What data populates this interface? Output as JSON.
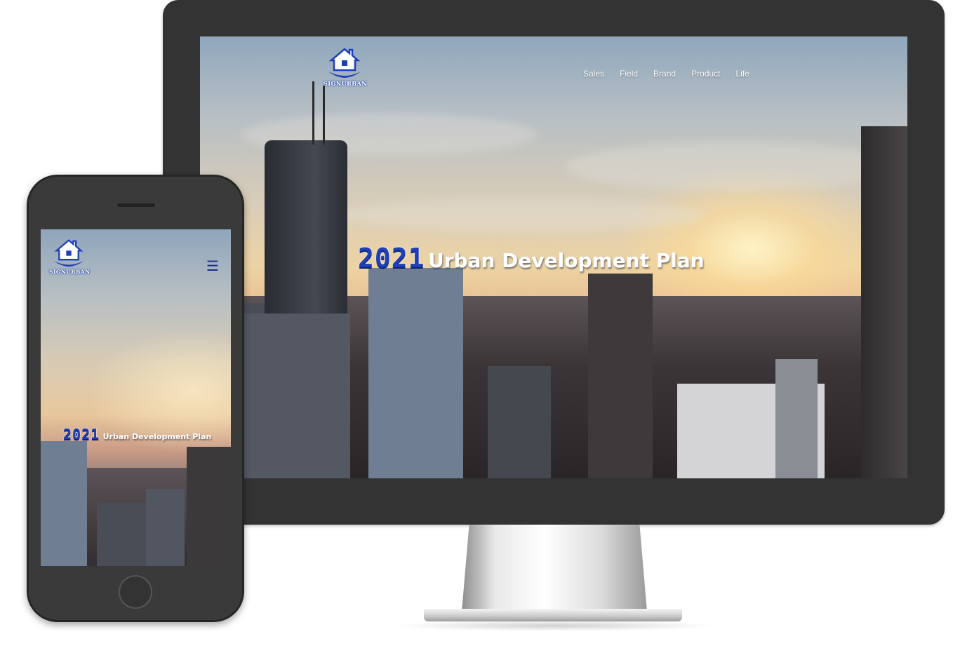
{
  "site": {
    "logo_text": "SIGNURBAN",
    "nav": [
      "Sales",
      "Field",
      "Brand",
      "Product",
      "Life"
    ],
    "hero": {
      "year": "2021",
      "title": "Urban Development Plan"
    },
    "menu_icon": "☰"
  },
  "devices": {
    "desktop": {
      "icon": "monitor-frame"
    },
    "mobile": {
      "icon": "phone-frame"
    }
  },
  "colors": {
    "brand_blue": "#1f3fb6",
    "device_frame": "#333333",
    "nav_text": "#ffffff"
  }
}
